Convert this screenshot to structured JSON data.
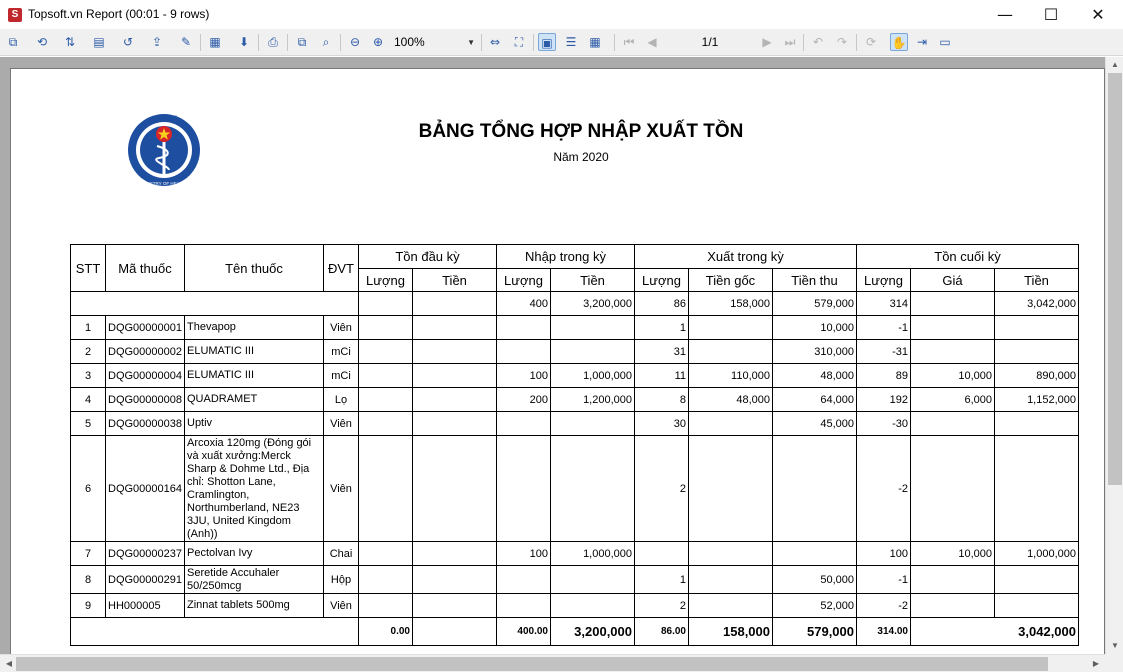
{
  "window": {
    "title": "Topsoft.vn Report (00:01 - 9 rows)",
    "app_icon": "S",
    "minimize_glyph": "—",
    "maximize_glyph": "☐",
    "close_glyph": "✕"
  },
  "toolbar": {
    "zoom": "100%",
    "page": "1/1",
    "icons": {
      "b1": "⧉",
      "b2": "⟲",
      "b3": "⇅",
      "b4": "▤",
      "b5": "↺",
      "b6": "⇪",
      "b7": "✎",
      "b8": "▦",
      "b9": "⬇",
      "b10": "⎙",
      "b11": "⧉",
      "b12": "⌕",
      "b13": "⊖",
      "b14": "⊕",
      "b15": "⇔",
      "b16": "⛶",
      "b17": "▣",
      "b18": "☰",
      "b19": "▦",
      "b20": "⏮",
      "b21": "◀",
      "b22": "▶",
      "b23": "⏭",
      "b24": "↶",
      "b25": "↷",
      "b26": "⟳",
      "b27": "✋",
      "b28": "⇥",
      "b29": "▭"
    }
  },
  "report": {
    "logo_text_top": "BỘ Y TẾ",
    "logo_text_bottom": "MINISTRY OF HEALTH",
    "title": "BẢNG TỔNG HỢP NHẬP XUẤT TỒN",
    "subtitle": "Năm 2020",
    "headers": {
      "stt": "STT",
      "ma_thuoc": "Mã thuốc",
      "ten_thuoc": "Tên thuốc",
      "dvt": "ĐVT",
      "ton_dau_ky": "Tồn đầu kỳ",
      "nhap_trong_ky": "Nhập trong kỳ",
      "xuat_trong_ky": "Xuất trong kỳ",
      "ton_cuoi_ky": "Tồn cuối kỳ",
      "luong": "Lượng",
      "tien": "Tiền",
      "tien_goc": "Tiền gốc",
      "tien_thu": "Tiền thu",
      "gia": "Giá"
    },
    "summary": {
      "nhap_luong": "400",
      "nhap_tien": "3,200,000",
      "xuat_luong": "86",
      "xuat_tien_goc": "158,000",
      "xuat_tien_thu": "579,000",
      "ton_luong": "314",
      "ton_tien": "3,042,000"
    },
    "rows": [
      {
        "stt": "1",
        "ma": "DQG00000001",
        "ten": "Thevapop",
        "dvt": "Viên",
        "dau_luong": "",
        "dau_tien": "",
        "nhap_luong": "",
        "nhap_tien": "",
        "xuat_luong": "1",
        "xuat_tien_goc": "",
        "xuat_tien_thu": "10,000",
        "ton_luong": "-1",
        "ton_gia": "",
        "ton_tien": ""
      },
      {
        "stt": "2",
        "ma": "DQG00000002",
        "ten": "ELUMATIC III",
        "dvt": "mCi",
        "dau_luong": "",
        "dau_tien": "",
        "nhap_luong": "",
        "nhap_tien": "",
        "xuat_luong": "31",
        "xuat_tien_goc": "",
        "xuat_tien_thu": "310,000",
        "ton_luong": "-31",
        "ton_gia": "",
        "ton_tien": ""
      },
      {
        "stt": "3",
        "ma": "DQG00000004",
        "ten": "ELUMATIC III",
        "dvt": "mCi",
        "dau_luong": "",
        "dau_tien": "",
        "nhap_luong": "100",
        "nhap_tien": "1,000,000",
        "xuat_luong": "11",
        "xuat_tien_goc": "110,000",
        "xuat_tien_thu": "48,000",
        "ton_luong": "89",
        "ton_gia": "10,000",
        "ton_tien": "890,000"
      },
      {
        "stt": "4",
        "ma": "DQG00000008",
        "ten": "QUADRAMET",
        "dvt": "Lọ",
        "dau_luong": "",
        "dau_tien": "",
        "nhap_luong": "200",
        "nhap_tien": "1,200,000",
        "xuat_luong": "8",
        "xuat_tien_goc": "48,000",
        "xuat_tien_thu": "64,000",
        "ton_luong": "192",
        "ton_gia": "6,000",
        "ton_tien": "1,152,000"
      },
      {
        "stt": "5",
        "ma": "DQG00000038",
        "ten": "Uptiv",
        "dvt": "Viên",
        "dau_luong": "",
        "dau_tien": "",
        "nhap_luong": "",
        "nhap_tien": "",
        "xuat_luong": "30",
        "xuat_tien_goc": "",
        "xuat_tien_thu": "45,000",
        "ton_luong": "-30",
        "ton_gia": "",
        "ton_tien": ""
      },
      {
        "stt": "6",
        "ma": "DQG00000164",
        "ten": "Arcoxia 120mg (Đóng gói và xuất xưởng:Merck Sharp & Dohme Ltd., Địa chỉ: Shotton Lane, Cramlington, Northumberland, NE23 3JU, United Kingdom (Anh))",
        "dvt": "Viên",
        "dau_luong": "",
        "dau_tien": "",
        "nhap_luong": "",
        "nhap_tien": "",
        "xuat_luong": "2",
        "xuat_tien_goc": "",
        "xuat_tien_thu": "",
        "ton_luong": "-2",
        "ton_gia": "",
        "ton_tien": ""
      },
      {
        "stt": "7",
        "ma": "DQG00000237",
        "ten": "Pectolvan Ivy",
        "dvt": "Chai",
        "dau_luong": "",
        "dau_tien": "",
        "nhap_luong": "100",
        "nhap_tien": "1,000,000",
        "xuat_luong": "",
        "xuat_tien_goc": "",
        "xuat_tien_thu": "",
        "ton_luong": "100",
        "ton_gia": "10,000",
        "ton_tien": "1,000,000"
      },
      {
        "stt": "8",
        "ma": "DQG00000291",
        "ten": "Seretide Accuhaler 50/250mcg",
        "dvt": "Hộp",
        "dau_luong": "",
        "dau_tien": "",
        "nhap_luong": "",
        "nhap_tien": "",
        "xuat_luong": "1",
        "xuat_tien_goc": "",
        "xuat_tien_thu": "50,000",
        "ton_luong": "-1",
        "ton_gia": "",
        "ton_tien": ""
      },
      {
        "stt": "9",
        "ma": "HH000005",
        "ten": "Zinnat tablets 500mg",
        "dvt": "Viên",
        "dau_luong": "",
        "dau_tien": "",
        "nhap_luong": "",
        "nhap_tien": "",
        "xuat_luong": "2",
        "xuat_tien_goc": "",
        "xuat_tien_thu": "52,000",
        "ton_luong": "-2",
        "ton_gia": "",
        "ton_tien": ""
      }
    ],
    "totals": {
      "dau_luong": "0.00",
      "nhap_luong": "400.00",
      "nhap_tien": "3,200,000",
      "xuat_luong": "86.00",
      "xuat_tien_goc": "158,000",
      "xuat_tien_thu": "579,000",
      "ton_luong": "314.00",
      "ton_tien": "3,042,000"
    }
  },
  "scrollbar": {
    "up_arrow": "▲",
    "down_arrow": "▼",
    "left_arrow": "◀",
    "right_arrow": "▶"
  }
}
